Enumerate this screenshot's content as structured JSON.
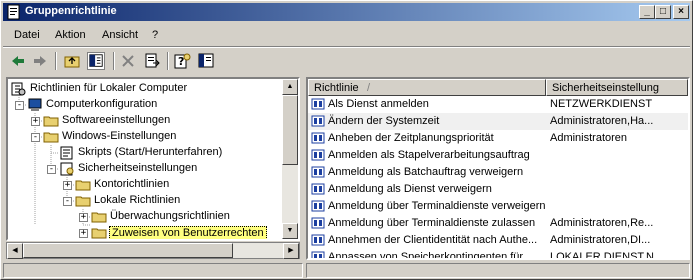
{
  "window": {
    "title": "Gruppenrichtlinie"
  },
  "menu": [
    {
      "label": "Datei"
    },
    {
      "label": "Aktion"
    },
    {
      "label": "Ansicht"
    },
    {
      "label": "?"
    }
  ],
  "tree": [
    {
      "label": "Richtlinien für Lokaler Computer",
      "icon": "policy-icon"
    },
    {
      "label": "Computerkonfiguration",
      "icon": "computer-icon"
    },
    {
      "label": "Softwareeinstellungen",
      "icon": "folder-icon"
    },
    {
      "label": "Windows-Einstellungen",
      "icon": "folder-icon"
    },
    {
      "label": "Skripts (Start/Herunterfahren)",
      "icon": "script-icon"
    },
    {
      "label": "Sicherheitseinstellungen",
      "icon": "security-icon"
    },
    {
      "label": "Kontorichtlinien",
      "icon": "folder-icon"
    },
    {
      "label": "Lokale Richtlinien",
      "icon": "folder-icon"
    },
    {
      "label": "Überwachungsrichtlinien",
      "icon": "folder-icon"
    },
    {
      "label": "Zuweisen von Benutzerrechten",
      "icon": "folder-icon"
    }
  ],
  "list": {
    "columns": [
      "Richtlinie",
      "Sicherheitseinstellung"
    ],
    "rows": [
      {
        "policy": "Als Dienst anmelden",
        "setting": "NETZWERKDIENST"
      },
      {
        "policy": "Ändern der Systemzeit",
        "setting": "Administratoren,Ha..."
      },
      {
        "policy": "Anheben der Zeitplanungspriorität",
        "setting": "Administratoren"
      },
      {
        "policy": "Anmelden als Stapelverarbeitungsauftrag",
        "setting": ""
      },
      {
        "policy": "Anmeldung als Batchauftrag verweigern",
        "setting": ""
      },
      {
        "policy": "Anmeldung als Dienst verweigern",
        "setting": ""
      },
      {
        "policy": "Anmeldung über Terminaldienste verweigern",
        "setting": ""
      },
      {
        "policy": "Anmeldung über Terminaldienste zulassen",
        "setting": "Administratoren,Re..."
      },
      {
        "policy": "Annehmen der Clientidentität nach Authe...",
        "setting": "Administratoren,DI..."
      },
      {
        "policy": "Anpassen von Speicherkontingenten für...",
        "setting": "LOKALER DIENST,N..."
      }
    ]
  },
  "colors": {
    "title_start": "#0a246a",
    "title_end": "#a6caf0",
    "selection": "#ffff80"
  }
}
